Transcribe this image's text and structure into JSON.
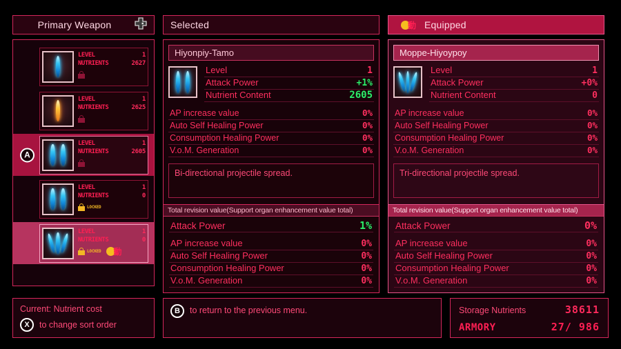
{
  "colors": {
    "accent_pink": "#d6275c",
    "text_red": "#ff2f5f",
    "positive_green": "#2bf06a",
    "gold": "#f5bd1f",
    "panel_bg": "#180209"
  },
  "left": {
    "header": {
      "title": "Primary Weapon",
      "icon": "dpad-icon"
    },
    "weapons": [
      {
        "level_label": "LEVEL",
        "level": "1",
        "nutrients_label": "NUTRIENTS",
        "nutrients": "2627",
        "lock_state": "unlocked",
        "lock_text": "",
        "state": "normal",
        "blades": 1,
        "blade_color": "blue",
        "badge": ""
      },
      {
        "level_label": "LEVEL",
        "level": "1",
        "nutrients_label": "NUTRIENTS",
        "nutrients": "2625",
        "lock_state": "unlocked",
        "lock_text": "",
        "state": "normal",
        "blades": 1,
        "blade_color": "orange",
        "badge": ""
      },
      {
        "level_label": "LEVEL",
        "level": "1",
        "nutrients_label": "NUTRIENTS",
        "nutrients": "2605",
        "lock_state": "unlocked",
        "lock_text": "",
        "state": "selected",
        "blades": 2,
        "blade_color": "blue",
        "badge": "",
        "cursor": "A"
      },
      {
        "level_label": "LEVEL",
        "level": "1",
        "nutrients_label": "NUTRIENTS",
        "nutrients": "0",
        "lock_state": "locked",
        "lock_text": "LOCKED",
        "state": "normal",
        "blades": 2,
        "blade_color": "blue",
        "badge": ""
      },
      {
        "level_label": "LEVEL",
        "level": "1",
        "nutrients_label": "NUTRIENTS",
        "nutrients": "0",
        "lock_state": "locked",
        "lock_text": "LOCKED",
        "state": "equipped",
        "blades": 3,
        "blade_color": "blue",
        "badge": "動"
      }
    ],
    "sort": {
      "current_label": "Current: Nutrient cost",
      "button": "X",
      "action": "to change sort order"
    }
  },
  "middle": {
    "header": "Selected",
    "weapon_name": "Hiyonpiy-Tamo",
    "main_stats": [
      {
        "label": "Level",
        "value": "1",
        "color": "red"
      },
      {
        "label": "Attack Power",
        "value": "+1%",
        "color": "green"
      },
      {
        "label": "Nutrient Content",
        "value": "2605",
        "color": "green"
      }
    ],
    "sub_stats": [
      {
        "label": "AP increase value",
        "value": "0%"
      },
      {
        "label": "Auto Self Healing Power",
        "value": "0%"
      },
      {
        "label": "Consumption Healing Power",
        "value": "0%"
      },
      {
        "label": "V.o.M. Generation",
        "value": "0%"
      }
    ],
    "description": "Bi-directional projectile spread.",
    "revision": {
      "title": "Total revision value(Support organ enhancement value total)",
      "main": {
        "label": "Attack Power",
        "value": "1%",
        "color": "green"
      },
      "rows": [
        {
          "label": "AP increase value",
          "value": "0%"
        },
        {
          "label": "Auto Self Healing Power",
          "value": "0%"
        },
        {
          "label": "Consumption Healing Power",
          "value": "0%"
        },
        {
          "label": "V.o.M. Generation",
          "value": "0%"
        }
      ]
    }
  },
  "right": {
    "header": "Equipped",
    "header_badge": "動",
    "weapon_name": "Moppe-Hiyoypoy",
    "main_stats": [
      {
        "label": "Level",
        "value": "1",
        "color": "red"
      },
      {
        "label": "Attack Power",
        "value": "+0%",
        "color": "red"
      },
      {
        "label": "Nutrient Content",
        "value": "0",
        "color": "red"
      }
    ],
    "sub_stats": [
      {
        "label": "AP increase value",
        "value": "0%"
      },
      {
        "label": "Auto Self Healing Power",
        "value": "0%"
      },
      {
        "label": "Consumption Healing Power",
        "value": "0%"
      },
      {
        "label": "V.o.M. Generation",
        "value": "0%"
      }
    ],
    "description": "Tri-directional projectile spread.",
    "revision": {
      "title": "Total revision value(Support organ enhancement value total)",
      "main": {
        "label": "Attack Power",
        "value": "0%",
        "color": "red"
      },
      "rows": [
        {
          "label": "AP increase value",
          "value": "0%"
        },
        {
          "label": "Auto Self Healing Power",
          "value": "0%"
        },
        {
          "label": "Consumption Healing Power",
          "value": "0%"
        },
        {
          "label": "V.o.M. Generation",
          "value": "0%"
        }
      ]
    }
  },
  "bottom": {
    "return_button": "B",
    "return_text": "to return to the previous menu.",
    "storage_label": "Storage Nutrients",
    "storage_value": "38611",
    "armory_label": "ARMORY",
    "armory_value": "27/ 986"
  }
}
